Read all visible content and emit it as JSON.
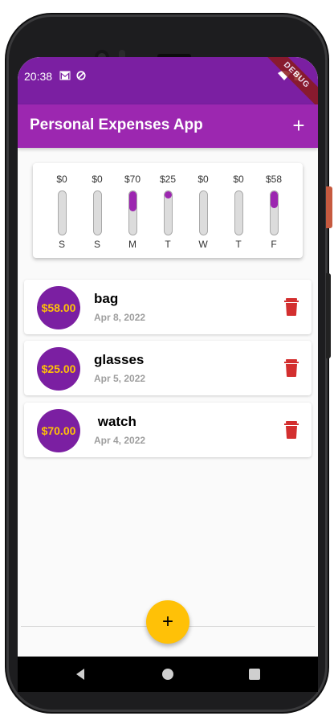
{
  "status_bar": {
    "time": "20:38",
    "icons": [
      "gmail-icon",
      "sync-icon",
      "wifi-icon",
      "battery-icon"
    ],
    "debug_banner": "DEBUG"
  },
  "app_bar": {
    "title": "Personal Expenses App",
    "add_icon": "plus-icon"
  },
  "chart": {
    "bars": [
      {
        "amount": "$0",
        "day": "S",
        "fill": 0
      },
      {
        "amount": "$0",
        "day": "S",
        "fill": 0
      },
      {
        "amount": "$70",
        "day": "M",
        "fill": 0.46
      },
      {
        "amount": "$25",
        "day": "T",
        "fill": 0.16
      },
      {
        "amount": "$0",
        "day": "W",
        "fill": 0
      },
      {
        "amount": "$0",
        "day": "T",
        "fill": 0
      },
      {
        "amount": "$58",
        "day": "F",
        "fill": 0.38
      }
    ]
  },
  "transactions": [
    {
      "amount": "$58.00",
      "title": "bag",
      "date": "Apr 8, 2022"
    },
    {
      "amount": "$25.00",
      "title": "glasses",
      "date": "Apr 5, 2022"
    },
    {
      "amount": "$70.00",
      "title": " watch",
      "date": "Apr 4, 2022"
    }
  ],
  "fab": {
    "label": "+"
  },
  "colors": {
    "primary": "#9c27b0",
    "primary_dark": "#7b1fa2",
    "accent": "#ffc107",
    "delete": "#d32f2f"
  },
  "nav_bar": {
    "buttons": [
      "back-icon",
      "home-icon",
      "recents-icon"
    ]
  }
}
